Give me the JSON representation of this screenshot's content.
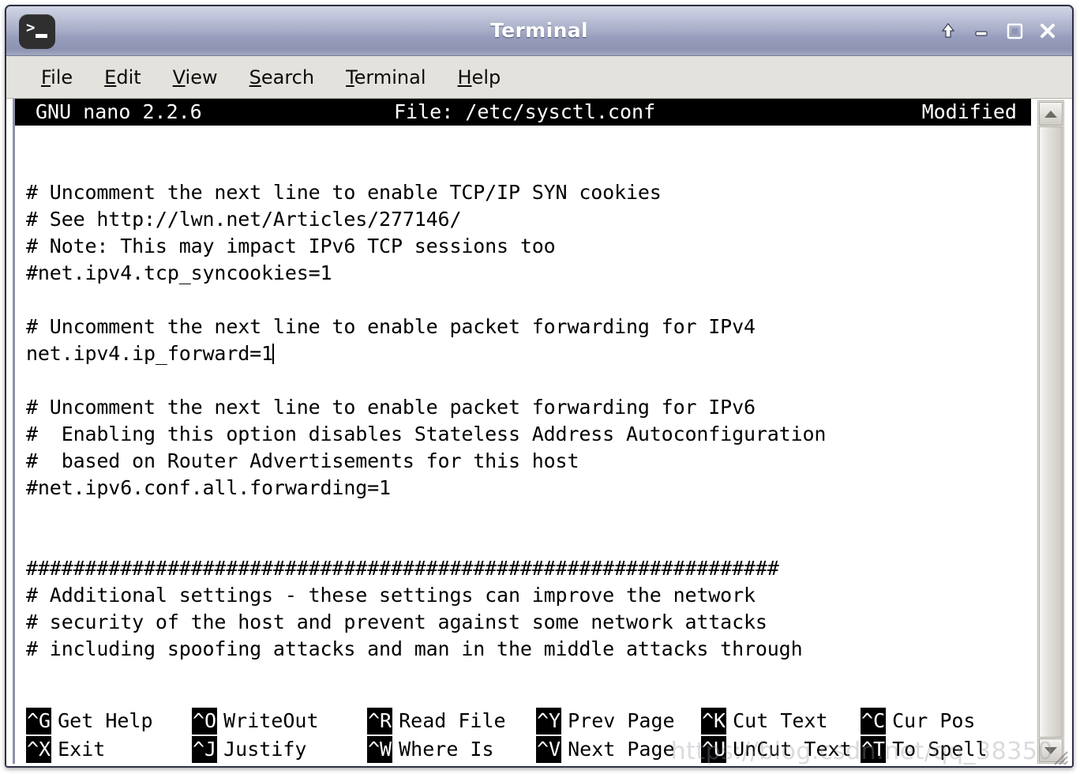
{
  "window": {
    "title": "Terminal",
    "icon": "terminal-icon",
    "buttons": [
      {
        "name": "shade-button",
        "glyph": "up-arrow-icon"
      },
      {
        "name": "minimize-button",
        "glyph": "minimize-icon"
      },
      {
        "name": "maximize-button",
        "glyph": "maximize-icon"
      },
      {
        "name": "close-button",
        "glyph": "close-icon"
      }
    ]
  },
  "menubar": {
    "items": [
      {
        "mnemonic": "F",
        "rest": "ile"
      },
      {
        "mnemonic": "E",
        "rest": "dit"
      },
      {
        "mnemonic": "V",
        "rest": "iew"
      },
      {
        "mnemonic": "S",
        "rest": "earch"
      },
      {
        "mnemonic": "T",
        "rest": "erminal"
      },
      {
        "mnemonic": "H",
        "rest": "elp"
      }
    ]
  },
  "nano": {
    "header": {
      "version": "GNU nano 2.2.6",
      "file": "File: /etc/sysctl.conf",
      "status": "Modified"
    },
    "lines": [
      "",
      "",
      "# Uncomment the next line to enable TCP/IP SYN cookies",
      "# See http://lwn.net/Articles/277146/",
      "# Note: This may impact IPv6 TCP sessions too",
      "#net.ipv4.tcp_syncookies=1",
      "",
      "# Uncomment the next line to enable packet forwarding for IPv4",
      "net.ipv4.ip_forward=1",
      "",
      "# Uncomment the next line to enable packet forwarding for IPv6",
      "#  Enabling this option disables Stateless Address Autoconfiguration",
      "#  based on Router Advertisements for this host",
      "#net.ipv6.conf.all.forwarding=1",
      "",
      "",
      "################################################################",
      "# Additional settings - these settings can improve the network",
      "# security of the host and prevent against some network attacks",
      "# including spoofing attacks and man in the middle attacks through"
    ],
    "cursor_line_index": 8,
    "shortcuts_row1": [
      {
        "key": "^G",
        "label": "Get Help"
      },
      {
        "key": "^O",
        "label": "WriteOut"
      },
      {
        "key": "^R",
        "label": "Read File"
      },
      {
        "key": "^Y",
        "label": "Prev Page"
      },
      {
        "key": "^K",
        "label": "Cut Text"
      },
      {
        "key": "^C",
        "label": "Cur Pos"
      }
    ],
    "shortcuts_row2": [
      {
        "key": "^X",
        "label": "Exit"
      },
      {
        "key": "^J",
        "label": "Justify"
      },
      {
        "key": "^W",
        "label": "Where Is"
      },
      {
        "key": "^V",
        "label": "Next Page"
      },
      {
        "key": "^U",
        "label": "UnCut Text"
      },
      {
        "key": "^T",
        "label": "To Spell"
      }
    ]
  },
  "scrollbar": {
    "up_arrow": "scroll-up-arrow",
    "down_arrow": "scroll-down-arrow"
  },
  "watermark": "https://blog.csdn.net/qq_38350",
  "colors": {
    "titlebar_top": "#d2d6e6",
    "titlebar_bottom": "#8d93b1",
    "window_border": "#2e3147",
    "menubar_bg": "#e4e2dd",
    "terminal_bg": "#ffffff",
    "terminal_fg": "#000000",
    "nano_header_bg": "#000000",
    "nano_header_fg": "#ffffff"
  }
}
